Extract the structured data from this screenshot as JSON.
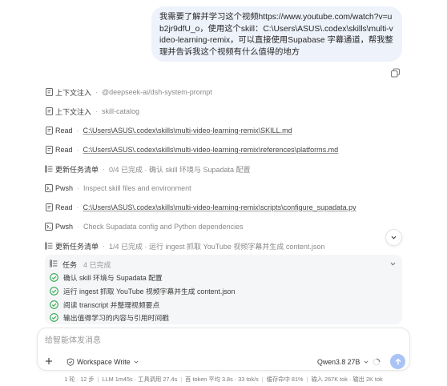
{
  "user_message": "我需要了解并学习这个视频https://www.youtube.com/watch?v=ub2jr9dfU_o，使用这个skill：C:\\Users\\ASUS\\.codex\\skills\\multi-video-learning-remix，可以直接使用Supabase 字幕通道，帮我整理并告诉我这个视频有什么值得的地方",
  "steps": [
    {
      "icon": "document-icon",
      "title": "上下文注入",
      "detail": "@deepseek-ai/dsh-system-prompt",
      "is_link": false
    },
    {
      "icon": "document-icon",
      "title": "上下文注入",
      "detail": "skill-catalog",
      "is_link": false
    },
    {
      "icon": "document-icon",
      "title": "Read",
      "detail": "C:\\Users\\ASUS\\.codex\\skills\\multi-video-learning-remix\\SKILL.md",
      "is_link": true
    },
    {
      "icon": "document-icon",
      "title": "Read",
      "detail": "C:\\Users\\ASUS\\.codex\\skills\\multi-video-learning-remix\\references\\platforms.md",
      "is_link": true
    },
    {
      "icon": "checklist-icon",
      "title": "更新任务清单",
      "detail": "0/4 已完成 · 确认 skill 环境与 Supadata 配置",
      "is_link": false
    },
    {
      "icon": "terminal-icon",
      "title": "Pwsh",
      "detail": "Inspect skill files and environment",
      "is_link": false
    },
    {
      "icon": "document-icon",
      "title": "Read",
      "detail": "C:\\Users\\ASUS\\.codex\\skills\\multi-video-learning-remix\\scripts\\configure_supadata.py",
      "is_link": true
    },
    {
      "icon": "terminal-icon",
      "title": "Pwsh",
      "detail": "Check Supadata config and Python dependencies",
      "is_link": false
    },
    {
      "icon": "checklist-icon",
      "title": "更新任务清单",
      "detail": "1/4 已完成 · 运行 ingest 抓取 YouTube 视频字幕并生成 content.json",
      "is_link": false
    }
  ],
  "tasks": {
    "label": "任务",
    "count": "4 已完成",
    "items": [
      "确认 skill 环境与 Supadata 配置",
      "运行 ingest 抓取 YouTube 视频字幕并生成 content.json",
      "阅读 transcript 并整理视频要点",
      "输出值得学习的内容与引用时间戳"
    ]
  },
  "composer": {
    "placeholder": "给智能体发消息",
    "workspace_label": "Workspace Write",
    "model_label": "Qwen3.8 27B"
  },
  "status_bar": [
    "1 轮 · 12 步",
    "LLM 1m45s · 工具调用 27.4s",
    "首 token 平均 3.8s · 33 tok/s",
    "缓存命中 81%",
    "输入 267K tok · 输出 2K tok"
  ],
  "colors": {
    "bubble": "#eef2fb",
    "check_green": "#2fa84f",
    "send": "#a9c3f5"
  }
}
